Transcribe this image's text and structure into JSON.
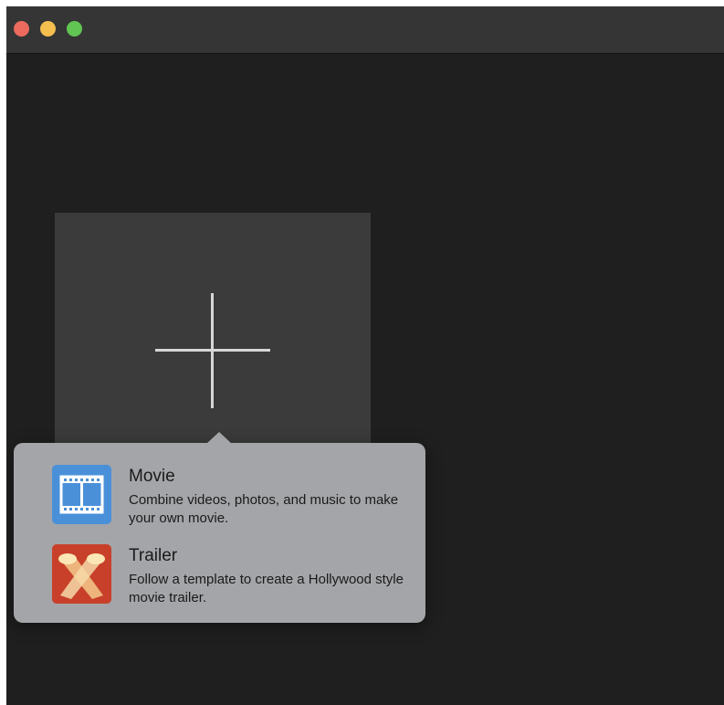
{
  "window": {
    "buttons": [
      "close",
      "minimize",
      "zoom"
    ]
  },
  "new_project_tile": {
    "icon": "plus-icon"
  },
  "popover": {
    "options": [
      {
        "title": "Movie",
        "description": "Combine videos, photos, and music to make your own movie.",
        "icon": "film-strip-icon",
        "icon_color": "#4a90d9"
      },
      {
        "title": "Trailer",
        "description": "Follow a template to create a Hollywood style movie trailer.",
        "icon": "spotlights-icon",
        "icon_color": "#c8402a"
      }
    ]
  },
  "colors": {
    "window_background": "#1f1f1f",
    "titlebar": "#353535",
    "tile": "#3b3b3b",
    "popover": "#a4a5a8"
  }
}
